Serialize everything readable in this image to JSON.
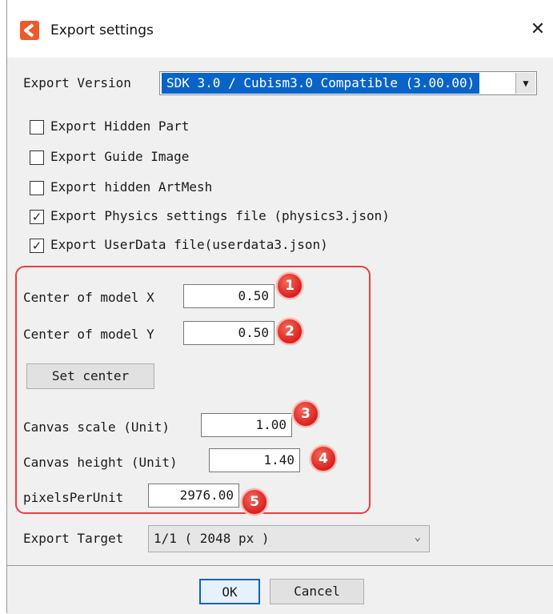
{
  "window": {
    "title": "Export settings",
    "close_glyph": "✕",
    "app_icon": "cubism-editor-logo-icon",
    "accent_color": "#ef5a2a"
  },
  "export_version": {
    "label": "Export Version",
    "selected": "SDK 3.0 / Cubism3.0 Compatible (3.00.00)",
    "arrow": "▼"
  },
  "options": [
    {
      "label": "Export Hidden Part",
      "checked": false
    },
    {
      "label": "Export Guide Image",
      "checked": false
    },
    {
      "label": "Export hidden ArtMesh",
      "checked": false
    },
    {
      "label": "Export Physics settings file (physics3.json)",
      "checked": true
    },
    {
      "label": "Export UserData file(userdata3.json)",
      "checked": true
    }
  ],
  "center": {
    "x_label": "Center of model X",
    "x_value": "0.50",
    "y_label": "Center of model Y",
    "y_value": "0.50",
    "set_center_label": "Set center"
  },
  "canvas": {
    "scale_label": "Canvas scale (Unit)",
    "scale_value": "1.00",
    "height_label": "Canvas height (Unit)",
    "height_value": "1.40",
    "ppu_label": "pixelsPerUnit",
    "ppu_value": "2976.00"
  },
  "badges": [
    "1",
    "2",
    "3",
    "4",
    "5"
  ],
  "badge_color": "#e02a2a",
  "highlight_frame_color": "#e83f3f",
  "export_target": {
    "label": "Export Target",
    "selected": "1/1 ( 2048 px )",
    "arrow": "⌄"
  },
  "buttons": {
    "ok": "OK",
    "cancel": "Cancel"
  }
}
